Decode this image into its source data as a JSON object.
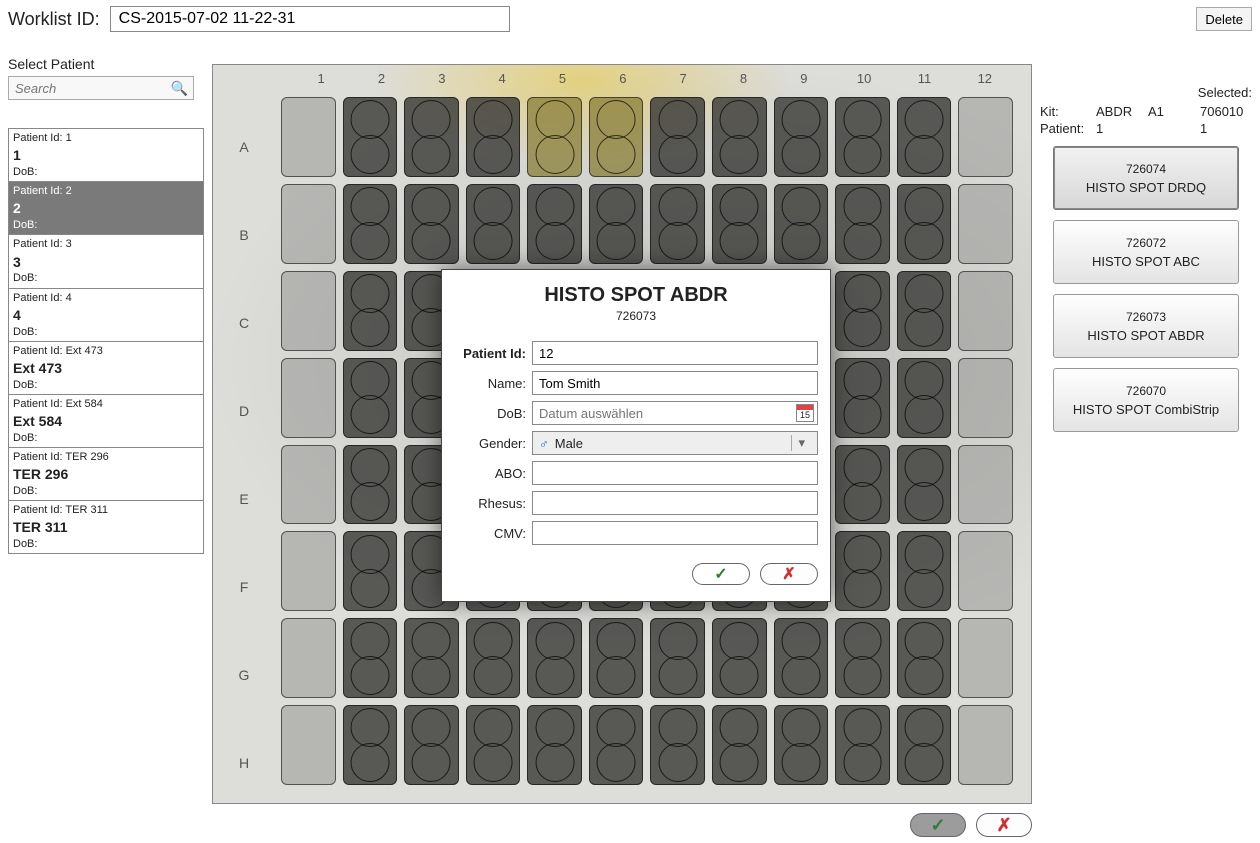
{
  "topbar": {
    "worklist_label": "Worklist ID:",
    "worklist_value": "CS-2015-07-02 11-22-31",
    "delete_label": "Delete"
  },
  "left": {
    "select_patient": "Select Patient",
    "search_placeholder": "Search",
    "patients": [
      {
        "pid_label": "Patient Id:  1",
        "main": "1",
        "dob_label": "DoB:",
        "selected": false
      },
      {
        "pid_label": "Patient Id:  2",
        "main": "2",
        "dob_label": "DoB:",
        "selected": true
      },
      {
        "pid_label": "Patient Id:  3",
        "main": "3",
        "dob_label": "DoB:",
        "selected": false
      },
      {
        "pid_label": "Patient Id:  4",
        "main": "4",
        "dob_label": "DoB:",
        "selected": false
      },
      {
        "pid_label": "Patient Id:  Ext 473",
        "main": "Ext 473",
        "dob_label": "DoB:",
        "selected": false
      },
      {
        "pid_label": "Patient Id:  Ext 584",
        "main": "Ext 584",
        "dob_label": "DoB:",
        "selected": false
      },
      {
        "pid_label": "Patient Id:  TER 296",
        "main": "TER 296",
        "dob_label": "DoB:",
        "selected": false
      },
      {
        "pid_label": "Patient Id:  TER 311",
        "main": "TER 311",
        "dob_label": "DoB:",
        "selected": false
      }
    ]
  },
  "plate": {
    "cols": [
      "1",
      "2",
      "3",
      "4",
      "5",
      "6",
      "7",
      "8",
      "9",
      "10",
      "11",
      "12"
    ],
    "rows": [
      "A",
      "B",
      "C",
      "D",
      "E",
      "F",
      "G",
      "H"
    ],
    "empty_cols": [
      1,
      12
    ],
    "yellow_cells": [
      "A5",
      "A6"
    ]
  },
  "right": {
    "selected_label": "Selected:",
    "kit_row": {
      "k": "Kit:",
      "v1": "ABDR",
      "v2": "A1",
      "v3": "706010"
    },
    "patient_row": {
      "k": "Patient:",
      "v1": "1",
      "v2": "",
      "v3": "1"
    },
    "kits": [
      {
        "code": "726074",
        "name": "HISTO SPOT DRDQ",
        "selected": true
      },
      {
        "code": "726072",
        "name": "HISTO SPOT ABC",
        "selected": false
      },
      {
        "code": "726073",
        "name": "HISTO SPOT ABDR",
        "selected": false
      },
      {
        "code": "726070",
        "name": "HISTO SPOT CombiStrip",
        "selected": false
      }
    ]
  },
  "modal": {
    "title": "HISTO SPOT ABDR",
    "code": "726073",
    "patient_id_label": "Patient Id:",
    "patient_id_value": "12",
    "name_label": "Name:",
    "name_value": "Tom Smith",
    "dob_label": "DoB:",
    "dob_placeholder": "Datum auswählen",
    "cal_day": "15",
    "gender_label": "Gender:",
    "gender_symbol": "♂",
    "gender_value": "Male",
    "abo_label": "ABO:",
    "abo_value": "",
    "rhesus_label": "Rhesus:",
    "rhesus_value": "",
    "cmv_label": "CMV:",
    "cmv_value": "",
    "confirm_glyph": "✓",
    "cancel_glyph": "✗"
  },
  "bottom": {
    "confirm_glyph": "✓",
    "cancel_glyph": "✗"
  }
}
